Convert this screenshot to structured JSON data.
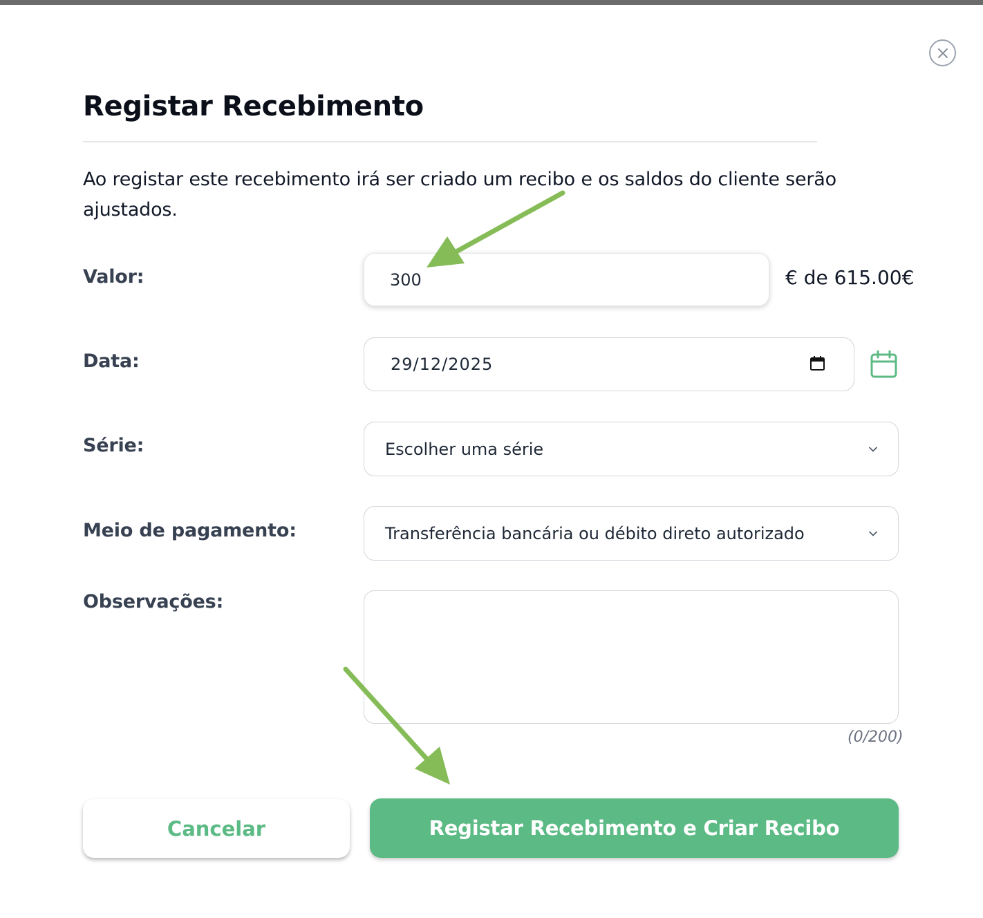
{
  "dialog": {
    "title": "Registar Recebimento",
    "description": "Ao registar este recebimento irá ser criado um recibo e os saldos do cliente serão ajustados."
  },
  "form": {
    "valor": {
      "label": "Valor:",
      "value": "300",
      "suffix": "€ de 615.00€"
    },
    "data": {
      "label": "Data:",
      "value": "29/12/2025"
    },
    "serie": {
      "label": "Série:",
      "value": "Escolher uma série"
    },
    "meio_pagamento": {
      "label": "Meio de pagamento:",
      "value": "Transferência bancária ou débito direto autorizado"
    },
    "observacoes": {
      "label": "Observações:",
      "value": "",
      "counter": "(0/200)"
    }
  },
  "buttons": {
    "cancel_label": "Cancelar",
    "submit_label": "Registar Recebimento e Criar Recibo"
  },
  "icons": {
    "close": "close-icon",
    "calendar_native": "calendar-icon",
    "calendar_picker": "calendar-icon",
    "dropdown": "chevron-down-icon",
    "annotation": "arrow-icon"
  },
  "colors": {
    "accent": "#5cba85",
    "annotation_arrow": "#86bc57"
  }
}
